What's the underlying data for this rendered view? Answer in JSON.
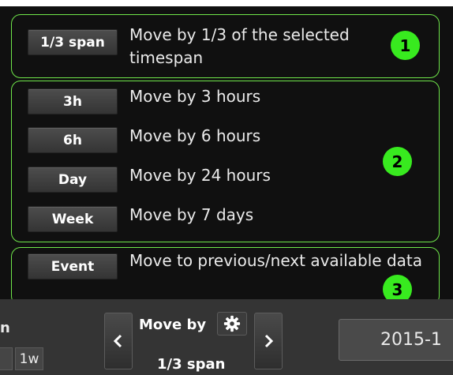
{
  "options": [
    {
      "button": "1/3 span",
      "description": "Move by 1/3 of the selected timespan"
    },
    {
      "button": "3h",
      "description": "Move by 3 hours"
    },
    {
      "button": "6h",
      "description": "Move by 6 hours"
    },
    {
      "button": "Day",
      "description": "Move by 24 hours"
    },
    {
      "button": "Week",
      "description": "Move by 7 days"
    },
    {
      "button": "Event",
      "description": "Move to previous/next available data"
    }
  ],
  "badges": [
    "1",
    "2",
    "3"
  ],
  "colors": {
    "group_border": "#6fe64a",
    "badge": "#38ea1f",
    "background": "#101010",
    "toolbar": "#343434"
  },
  "toolbar": {
    "edge_text": "n",
    "edge_button": "1w",
    "prev_icon": "chevron-left-icon",
    "next_icon": "chevron-right-icon",
    "move_by_label": "Move by",
    "settings_icon": "gear-icon",
    "move_by_value": "1/3 span",
    "date": "2015-1"
  }
}
